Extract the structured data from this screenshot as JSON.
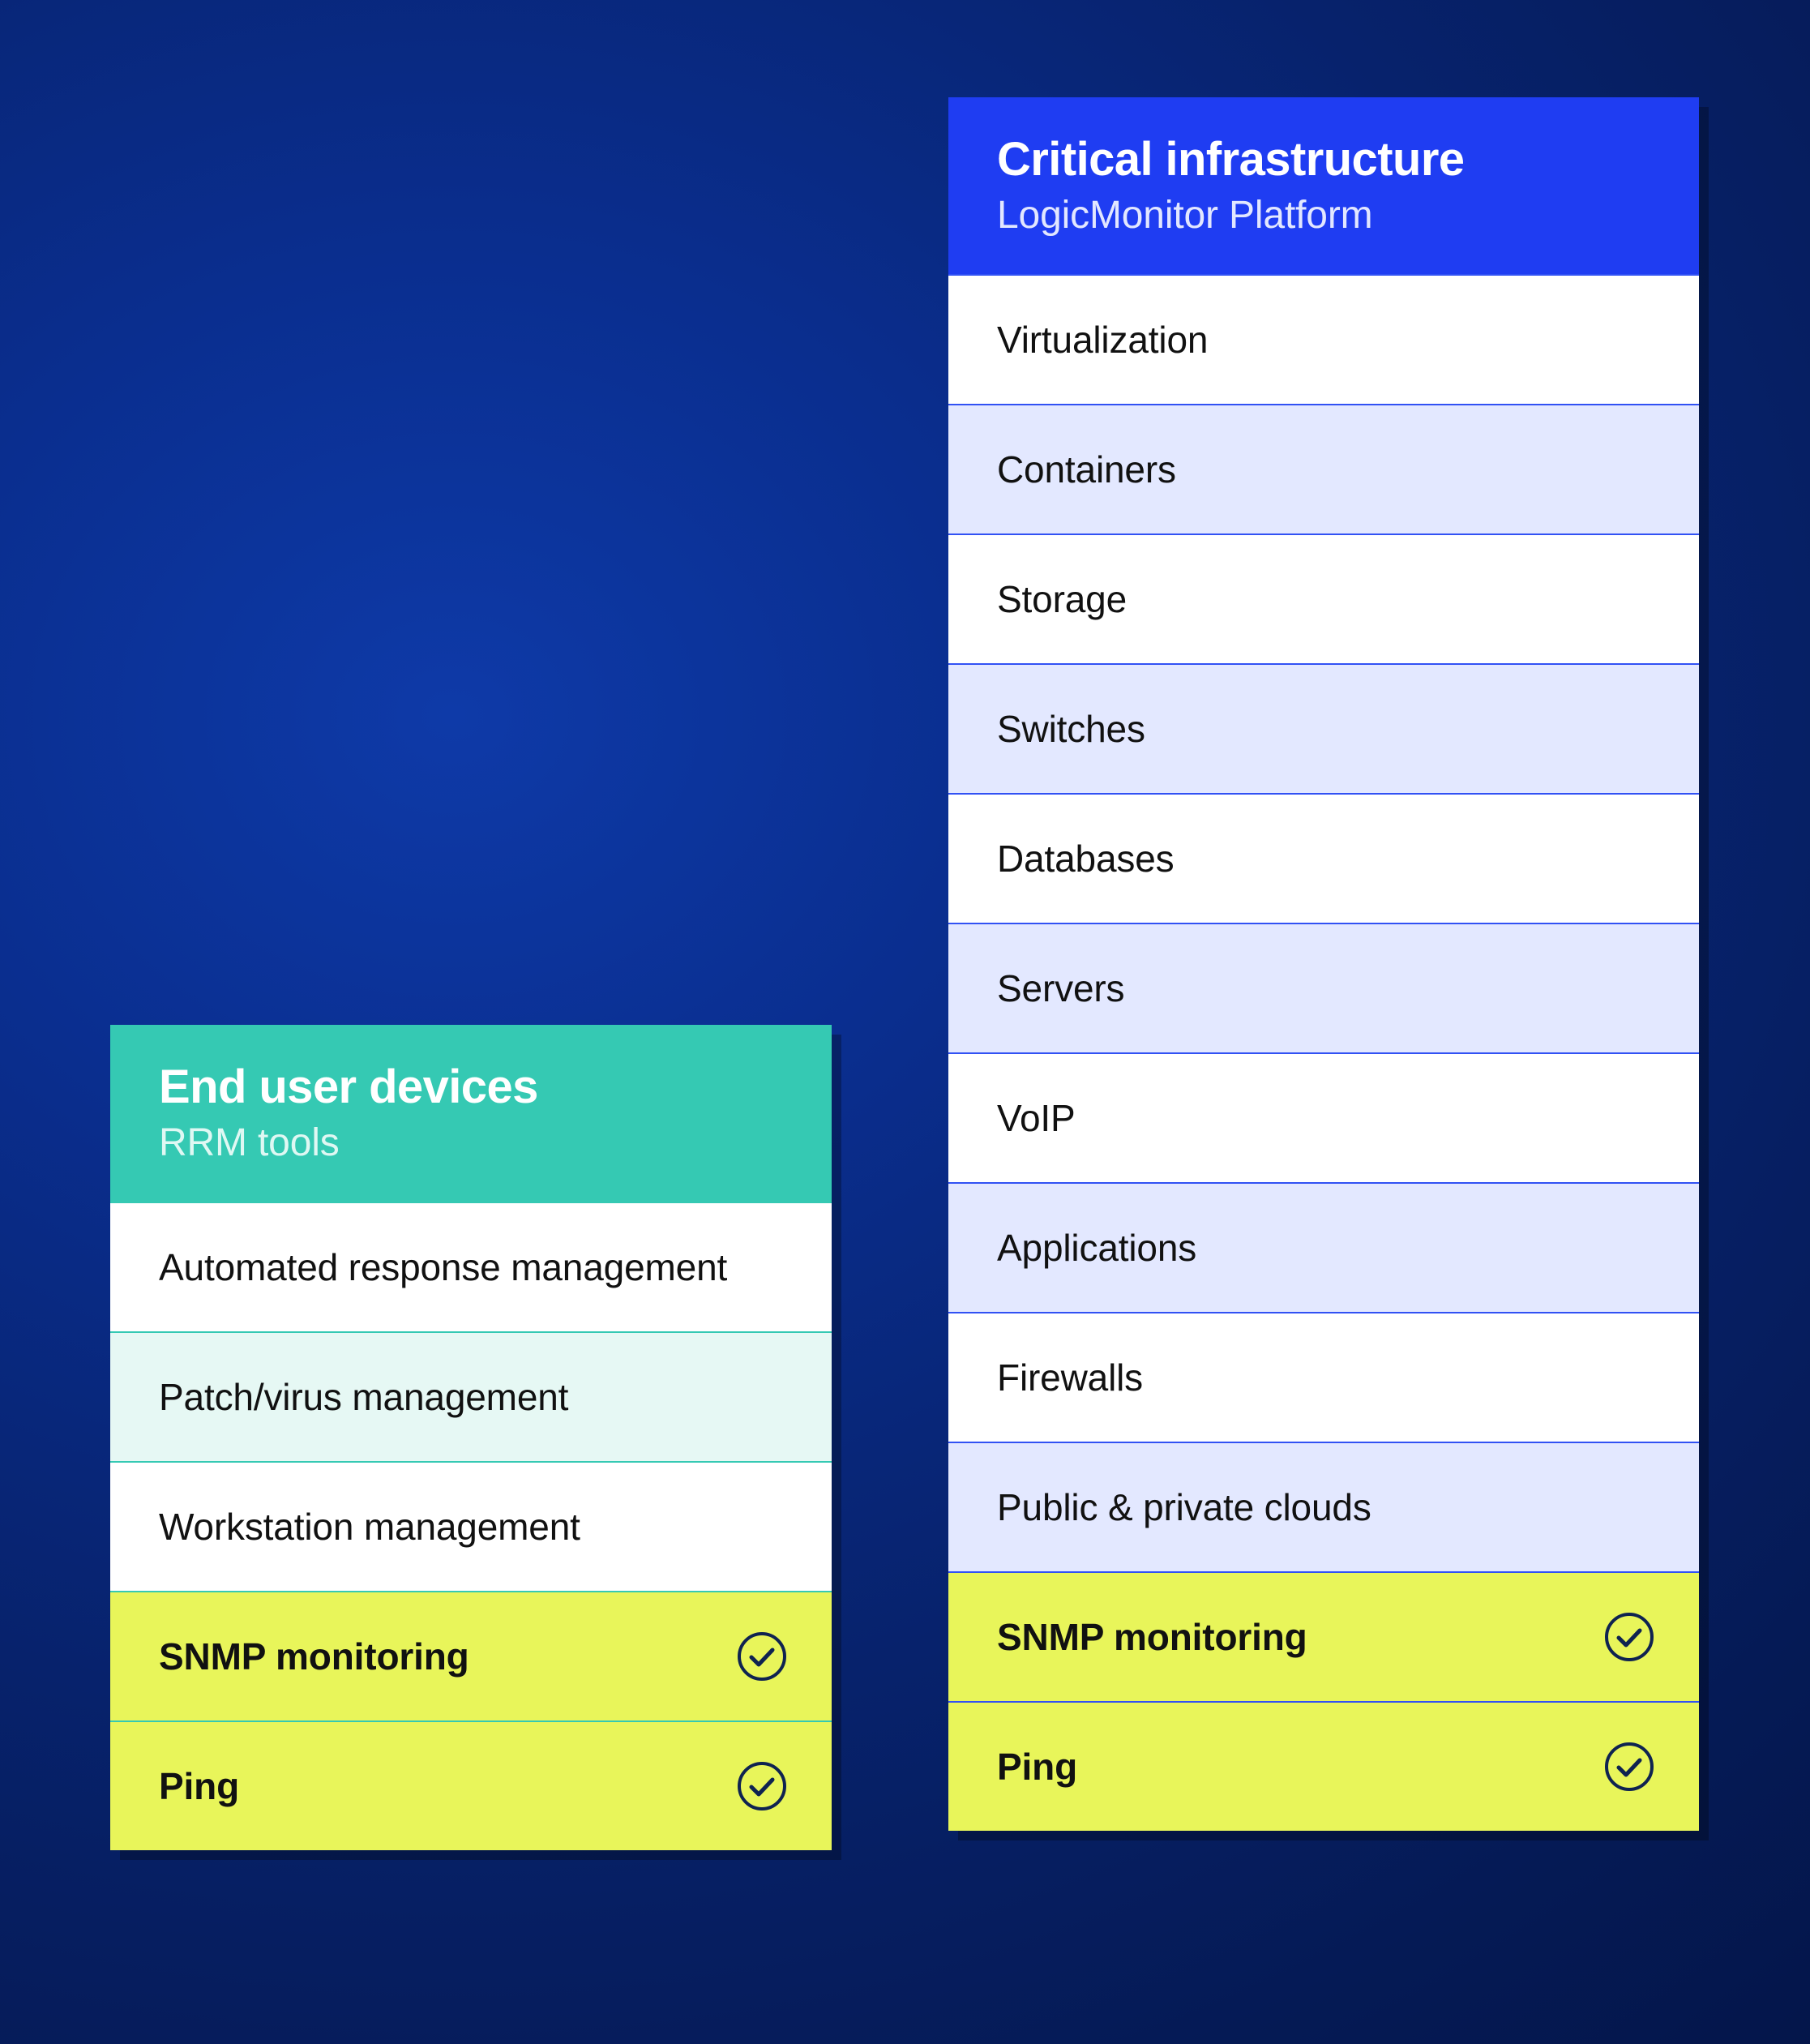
{
  "left_card": {
    "title": "End user devices",
    "subtitle": "RRM tools",
    "rows": [
      {
        "label": "Automated response management",
        "tint": false,
        "highlight": false,
        "check": false
      },
      {
        "label": "Patch/virus management",
        "tint": true,
        "highlight": false,
        "check": false
      },
      {
        "label": "Workstation management",
        "tint": false,
        "highlight": false,
        "check": false
      },
      {
        "label": "SNMP monitoring",
        "tint": false,
        "highlight": true,
        "check": true
      },
      {
        "label": "Ping",
        "tint": false,
        "highlight": true,
        "check": true
      }
    ]
  },
  "right_card": {
    "title": "Critical infrastructure",
    "subtitle": "LogicMonitor Platform",
    "rows": [
      {
        "label": "Virtualization",
        "tint": false,
        "highlight": false,
        "check": false
      },
      {
        "label": "Containers",
        "tint": true,
        "highlight": false,
        "check": false
      },
      {
        "label": "Storage",
        "tint": false,
        "highlight": false,
        "check": false
      },
      {
        "label": "Switches",
        "tint": true,
        "highlight": false,
        "check": false
      },
      {
        "label": "Databases",
        "tint": false,
        "highlight": false,
        "check": false
      },
      {
        "label": "Servers",
        "tint": true,
        "highlight": false,
        "check": false
      },
      {
        "label": "VoIP",
        "tint": false,
        "highlight": false,
        "check": false
      },
      {
        "label": "Applications",
        "tint": true,
        "highlight": false,
        "check": false
      },
      {
        "label": "Firewalls",
        "tint": false,
        "highlight": false,
        "check": false
      },
      {
        "label": "Public & private clouds",
        "tint": true,
        "highlight": false,
        "check": false
      },
      {
        "label": "SNMP monitoring",
        "tint": false,
        "highlight": true,
        "check": true
      },
      {
        "label": "Ping",
        "tint": false,
        "highlight": true,
        "check": true
      }
    ]
  }
}
